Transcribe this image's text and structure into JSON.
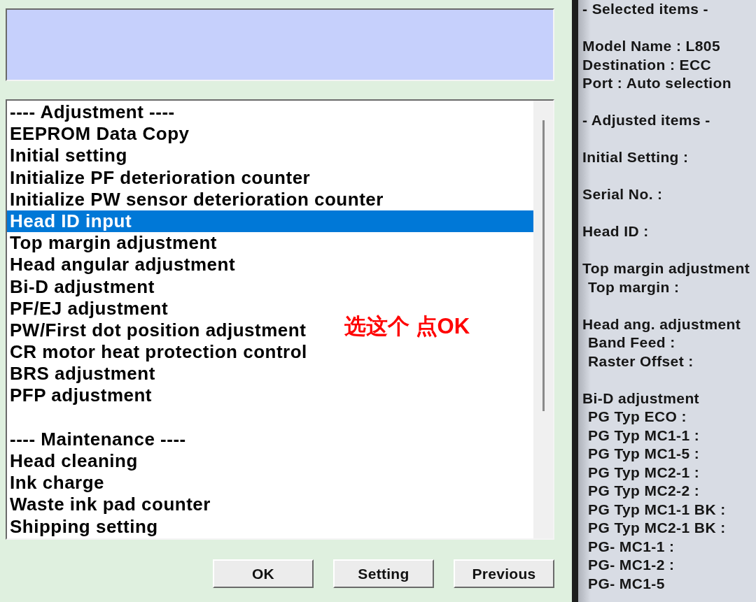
{
  "list": {
    "sections": [
      {
        "header": {
          "label": "---- Adjustment ----",
          "selected": false
        },
        "items": [
          {
            "label": "EEPROM Data Copy",
            "selected": false
          },
          {
            "label": "Initial setting",
            "selected": false
          },
          {
            "label": "Initialize PF deterioration counter",
            "selected": false
          },
          {
            "label": "Initialize PW sensor deterioration counter",
            "selected": false
          },
          {
            "label": "Head ID input",
            "selected": true
          },
          {
            "label": "Top margin adjustment",
            "selected": false
          },
          {
            "label": "Head angular adjustment",
            "selected": false
          },
          {
            "label": "Bi-D adjustment",
            "selected": false
          },
          {
            "label": "PF/EJ adjustment",
            "selected": false
          },
          {
            "label": "PW/First dot position adjustment",
            "selected": false
          },
          {
            "label": "CR motor heat protection control",
            "selected": false
          },
          {
            "label": "BRS adjustment",
            "selected": false
          },
          {
            "label": "PFP adjustment",
            "selected": false
          }
        ]
      },
      {
        "header": {
          "label": "---- Maintenance ----",
          "selected": false
        },
        "items": [
          {
            "label": "Head cleaning",
            "selected": false
          },
          {
            "label": "Ink charge",
            "selected": false
          },
          {
            "label": "Waste ink pad counter",
            "selected": false
          },
          {
            "label": "Shipping setting",
            "selected": false
          }
        ]
      }
    ]
  },
  "annotation": "选这个 点OK",
  "buttons": [
    "OK",
    "Setting",
    "Previous"
  ],
  "info_panel": {
    "selected_heading": "- Selected items -",
    "selected_items": [
      "Model Name : L805",
      "Destination : ECC",
      "Port : Auto selection"
    ],
    "adjusted_heading": "- Adjusted items -",
    "adjusted_items": [
      {
        "label": "Initial Setting :"
      },
      {
        "label": "Serial No. :"
      },
      {
        "label": "Head ID :"
      },
      {
        "label": "Top margin adjustment",
        "children": [
          {
            "label": "Top margin :"
          }
        ]
      },
      {
        "label": "Head ang. adjustment",
        "children": [
          {
            "label": "Band Feed :"
          },
          {
            "label": "Raster Offset :"
          }
        ]
      },
      {
        "label": "Bi-D adjustment",
        "children": [
          {
            "label": "PG Typ ECO :"
          },
          {
            "label": "PG Typ MC1-1 :"
          },
          {
            "label": "PG Typ MC1-5 :"
          },
          {
            "label": "PG Typ MC2-1 :"
          },
          {
            "label": "PG Typ MC2-2 :"
          },
          {
            "label": "PG Typ MC1-1 BK :"
          },
          {
            "label": "PG Typ MC2-1 BK :"
          },
          {
            "label": "PG- MC1-1 :"
          },
          {
            "label": "PG- MC1-2 :"
          },
          {
            "label": "PG- MC1-5"
          }
        ]
      }
    ]
  }
}
